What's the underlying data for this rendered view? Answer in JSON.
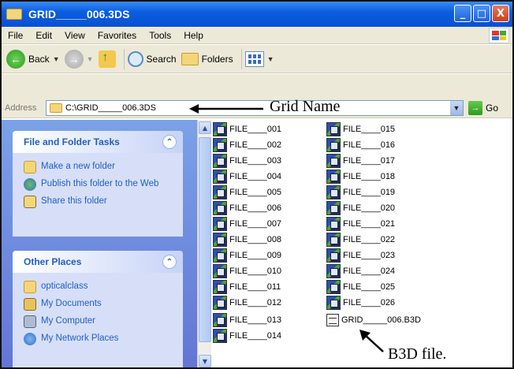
{
  "window": {
    "title": "GRID_____006.3DS",
    "controls": {
      "minimize": "_",
      "maximize": "□",
      "close": "X"
    }
  },
  "menubar": {
    "items": [
      "File",
      "Edit",
      "View",
      "Favorites",
      "Tools",
      "Help"
    ]
  },
  "toolbar": {
    "back_label": "Back",
    "search_label": "Search",
    "folders_label": "Folders"
  },
  "address": {
    "label": "Address",
    "value": "C:\\GRID_____006.3DS",
    "go_label": "Go"
  },
  "annotations": {
    "grid_name": "Grid Name",
    "b3d_file": "B3D file."
  },
  "left_pane": {
    "file_tasks": {
      "title": "File and Folder Tasks",
      "items": [
        "Make a new folder",
        "Publish this folder to the Web",
        "Share this folder"
      ]
    },
    "other_places": {
      "title": "Other Places",
      "items": [
        "opticalclass",
        "My Documents",
        "My Computer",
        "My Network Places"
      ]
    }
  },
  "files": {
    "column1": [
      "FILE____001",
      "FILE____002",
      "FILE____003",
      "FILE____004",
      "FILE____005",
      "FILE____006",
      "FILE____007",
      "FILE____008",
      "FILE____009",
      "FILE____010",
      "FILE____011",
      "FILE____012",
      "FILE____013",
      "FILE____014"
    ],
    "column2": [
      "FILE____015",
      "FILE____016",
      "FILE____017",
      "FILE____018",
      "FILE____019",
      "FILE____020",
      "FILE____021",
      "FILE____022",
      "FILE____023",
      "FILE____024",
      "FILE____025",
      "FILE____026"
    ],
    "b3d_file": "GRID_____006.B3D"
  }
}
